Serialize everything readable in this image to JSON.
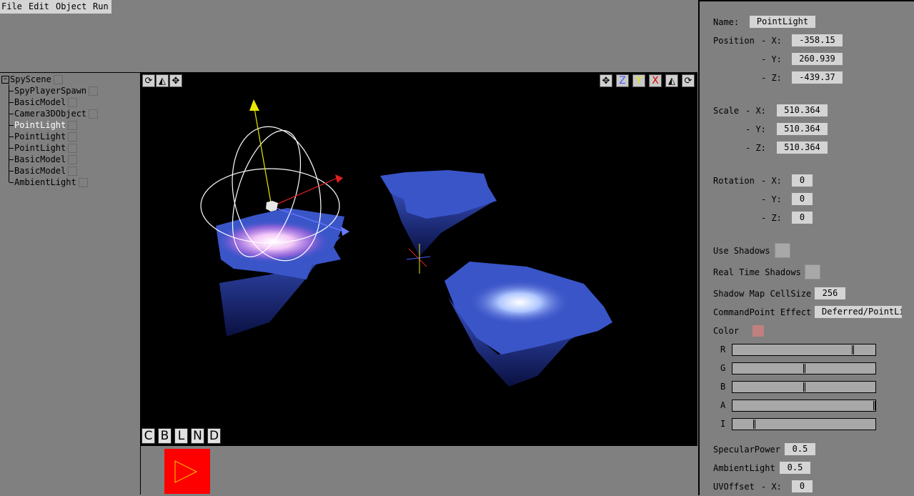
{
  "menu": [
    "File",
    "Edit",
    "Object",
    "Run"
  ],
  "tree": {
    "root": "SpyScene",
    "items": [
      "SpyPlayerSpawn",
      "BasicModel",
      "Camera3DObject",
      "PointLight",
      "PointLight",
      "PointLight",
      "BasicModel",
      "BasicModel",
      "AmbientLight"
    ],
    "selected_index": 3
  },
  "viewport": {
    "left_tools": [
      "rotate-icon",
      "scale-icon",
      "move-icon"
    ],
    "right_tools": [
      {
        "icon": "move-icon",
        "label": "",
        "color": ""
      },
      {
        "icon": "axis-z",
        "label": "Z",
        "color": "#4a60ff"
      },
      {
        "icon": "axis-y",
        "label": "Y",
        "color": "#e8e800"
      },
      {
        "icon": "axis-x",
        "label": "X",
        "color": "#e00000"
      },
      {
        "icon": "scale-icon",
        "label": "",
        "color": ""
      },
      {
        "icon": "rotate-icon",
        "label": "",
        "color": ""
      }
    ],
    "modes": [
      "C",
      "B",
      "L",
      "N",
      "D"
    ]
  },
  "props": {
    "name_label": "Name:",
    "name_value": "PointLight",
    "position_label": "Position",
    "position": {
      "x": "-358.15",
      "y": "260.939",
      "z": "-439.37"
    },
    "scale_label": "Scale",
    "scale": {
      "x": "510.364",
      "y": "510.364",
      "z": "510.364"
    },
    "rotation_label": "Rotation",
    "rotation": {
      "x": "0",
      "y": "0",
      "z": "0"
    },
    "axis_x": "- X:",
    "axis_y": "- Y:",
    "axis_z": "- Z:",
    "use_shadows_label": "Use Shadows",
    "realtime_shadows_label": "Real Time Shadows",
    "shadow_cellsize_label": "Shadow Map CellSize",
    "shadow_cellsize_value": "256",
    "cmdpoint_label": "CommandPoint Effect",
    "cmdpoint_value": "Deferred/PointLi",
    "color_label": "Color",
    "color_swatch": "#c08080",
    "sliders": [
      {
        "label": "R",
        "value": 0.84
      },
      {
        "label": "G",
        "value": 0.5
      },
      {
        "label": "B",
        "value": 0.5
      },
      {
        "label": "A",
        "value": 1.0
      },
      {
        "label": "I",
        "value": 0.15
      }
    ],
    "specular_label": "SpecularPower",
    "specular_value": "0.5",
    "ambient_label": "AmbientLight",
    "ambient_value": "0.5",
    "uvoffset_label": "UVOffset",
    "uvoffset_x": "0"
  },
  "colors": {
    "play_button": "#ff0000",
    "play_icon": "#ffd000",
    "selected_tree": "#ffffff"
  }
}
